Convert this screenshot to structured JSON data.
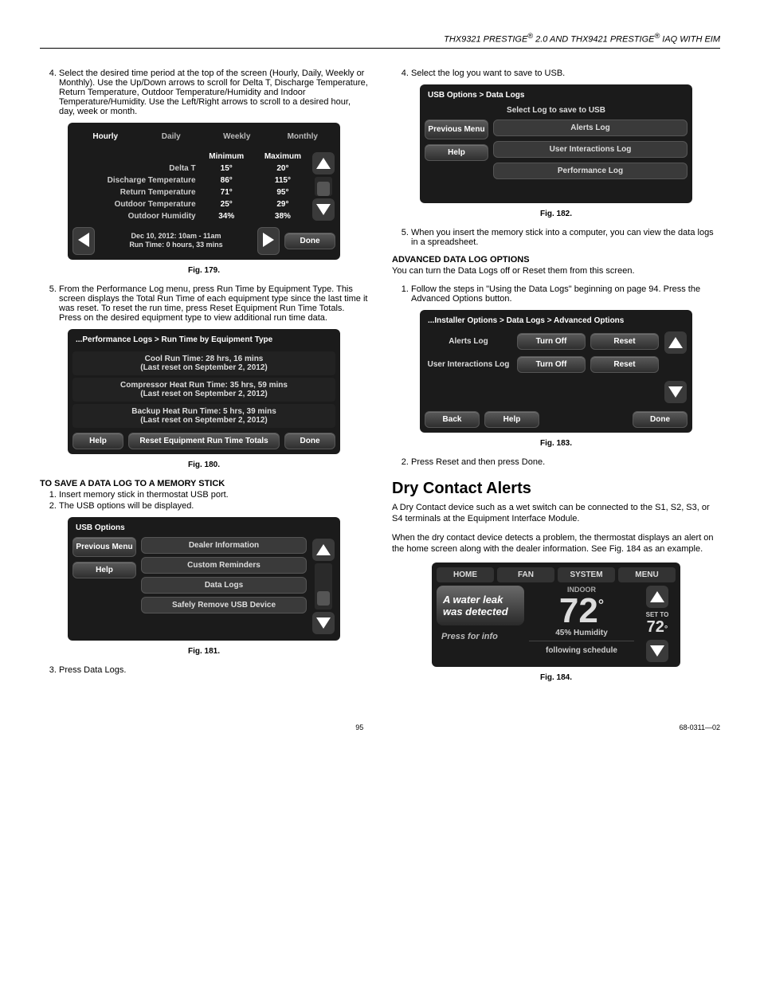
{
  "header": {
    "left": "THX9321 PRESTIGE",
    "mid1": " 2.0 AND THX9421 PRESTIGE",
    "right": " IAQ WITH EIM",
    "reg": "®"
  },
  "col1": {
    "step4": "Select the desired time period at the top of the screen (Hourly, Daily, Weekly or Monthly). Use the Up/Down arrows to scroll for Delta T, Discharge Temperature, Return Temperature, Outdoor Temperature/Humidity and Indoor Temperature/Humidity. Use the Left/Right arrows to scroll to a desired hour, day, week or month.",
    "fig179": {
      "tabs": [
        "Hourly",
        "Daily",
        "Weekly",
        "Monthly"
      ],
      "head_min": "Minimum",
      "head_max": "Maximum",
      "rows": [
        {
          "label": "Delta T",
          "min": "15°",
          "max": "20°"
        },
        {
          "label": "Discharge Temperature",
          "min": "86°",
          "max": "115°"
        },
        {
          "label": "Return Temperature",
          "min": "71°",
          "max": "95°"
        },
        {
          "label": "Outdoor Temperature",
          "min": "25°",
          "max": "29°"
        },
        {
          "label": "Outdoor Humidity",
          "min": "34%",
          "max": "38%"
        }
      ],
      "time1": "Dec 10, 2012: 10am - 11am",
      "time2": "Run Time: 0 hours, 33 mins",
      "done": "Done",
      "caption": "Fig. 179."
    },
    "step5": "From the Performance Log menu, press Run Time by Equipment Type. This screen displays the Total Run Time of each equipment type since the last time it was reset. To reset the run time, press Reset Equipment Run Time Totals. Press on the desired equipment type to view additional run time data.",
    "fig180": {
      "crumb": "...Performance Logs > Run Time by Equipment Type",
      "rows": [
        {
          "a": "Cool Run Time: 28 hrs, 16 mins",
          "b": "(Last reset on September 2, 2012)"
        },
        {
          "a": "Compressor Heat Run Time: 35 hrs, 59 mins",
          "b": "(Last reset on September 2, 2012)"
        },
        {
          "a": "Backup Heat Run Time: 5 hrs, 39 mins",
          "b": "(Last reset on September 2, 2012)"
        }
      ],
      "help": "Help",
      "reset": "Reset Equipment Run Time Totals",
      "done": "Done",
      "caption": "Fig. 180."
    },
    "save_head": "TO SAVE A DATA LOG TO A MEMORY STICK",
    "save1": "Insert memory stick in thermostat USB port.",
    "save2": "The USB options will be displayed.",
    "fig181": {
      "crumb": "USB Options",
      "prev": "Previous Menu",
      "help": "Help",
      "items": [
        "Dealer Information",
        "Custom Reminders",
        "Data Logs",
        "Safely Remove USB Device"
      ],
      "caption": "Fig. 181."
    },
    "step3": "Press Data Logs."
  },
  "col2": {
    "step4": "Select the log you want to save to USB.",
    "fig182": {
      "crumb": "USB Options > Data Logs",
      "sub": "Select Log to save to USB",
      "prev": "Previous Menu",
      "help": "Help",
      "items": [
        "Alerts Log",
        "User Interactions Log",
        "Performance Log"
      ],
      "caption": "Fig. 182."
    },
    "step5": "When you insert the memory stick into a computer, you can view the data logs in a spreadsheet.",
    "adv_head": "ADVANCED DATA LOG OPTIONS",
    "adv_p": "You can turn the Data Logs off or Reset them from this screen.",
    "adv1": "Follow the steps in \"Using the Data Logs\" beginning on page 94. Press the Advanced Options button.",
    "fig183": {
      "crumb": "...Installer Options > Data Logs > Advanced Options",
      "alerts": "Alerts Log",
      "uil": "User Interactions Log",
      "turnoff": "Turn Off",
      "reset": "Reset",
      "back": "Back",
      "help": "Help",
      "done": "Done",
      "caption": "Fig. 183."
    },
    "adv2": "Press Reset and then press Done.",
    "dry_h": "Dry Contact Alerts",
    "dry_p1": "A Dry Contact device such as a wet switch can be connected to the S1, S2, S3, or S4 terminals at the Equipment Interface Module.",
    "dry_p2": "When the dry contact device detects a problem, the thermostat displays an alert on the home screen along with the dealer information. See Fig. 184 as an example.",
    "fig184": {
      "tabs": [
        "HOME",
        "FAN",
        "SYSTEM",
        "MENU"
      ],
      "alert1": "A water leak",
      "alert2": "was detected",
      "press": "Press for info",
      "indoor": "INDOOR",
      "temp": "72",
      "deg": "°",
      "hum": "45% Humidity",
      "setto": "SET TO",
      "set_temp": "72",
      "following": "following schedule",
      "caption": "Fig. 184."
    }
  },
  "footer": {
    "page": "95",
    "doc": "68-0311—02"
  }
}
